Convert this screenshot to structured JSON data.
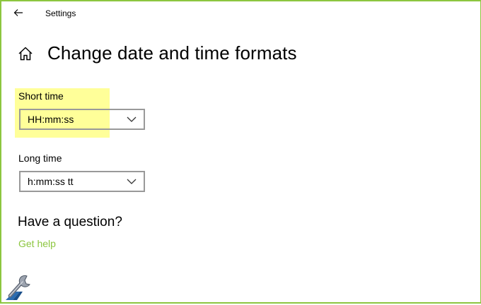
{
  "window": {
    "title": "Settings",
    "accent_color": "#8cc63f"
  },
  "header": {
    "back_icon": "back-arrow-icon",
    "home_icon": "home-icon",
    "page_title": "Change date and time formats"
  },
  "formats": {
    "short_time": {
      "label": "Short time",
      "value": "HH:mm:ss",
      "highlight_color": "#ffff99"
    },
    "long_time": {
      "label": "Long time",
      "value": "h:mm:ss tt"
    }
  },
  "help": {
    "heading": "Have a question?",
    "link": "Get help",
    "link_color": "#8cc63f"
  },
  "watermark": {
    "icon": "wrench-logo-icon"
  }
}
